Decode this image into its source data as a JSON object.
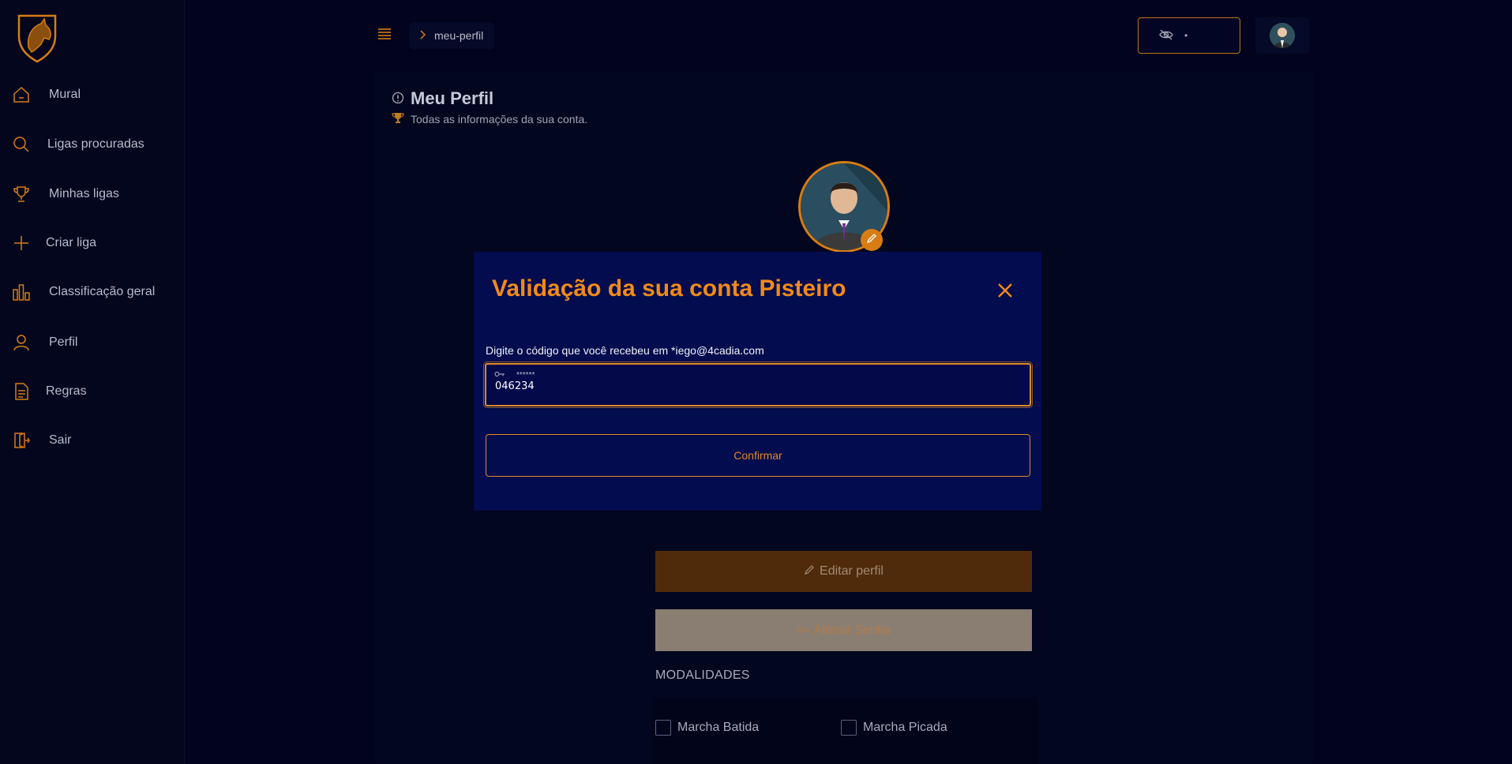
{
  "sidebar": {
    "items": [
      {
        "label": "Mural",
        "icon": "home-icon"
      },
      {
        "label": "Ligas procuradas",
        "icon": "search-icon"
      },
      {
        "label": "Minhas ligas",
        "icon": "trophy-icon"
      },
      {
        "label": "Criar liga",
        "icon": "plus-icon"
      },
      {
        "label": "Classificação geral",
        "icon": "bar-chart-icon"
      },
      {
        "label": "Perfil",
        "icon": "user-icon"
      },
      {
        "label": "Regras",
        "icon": "document-icon"
      },
      {
        "label": "Sair",
        "icon": "logout-icon"
      }
    ]
  },
  "header": {
    "breadcrumb": "meu-perfil",
    "visibility_value": "•"
  },
  "page": {
    "title": "Meu Perfil",
    "subtitle": "Todas as informações da sua conta.",
    "edit_profile_label": "Editar perfil",
    "change_password_label": "Alterar Senha",
    "modalidades_title": "MODALIDADES",
    "modalidades": [
      {
        "label": "Marcha Batida",
        "checked": false
      },
      {
        "label": "Marcha Picada",
        "checked": false
      }
    ]
  },
  "modal": {
    "title": "Validação da sua conta Pisteiro",
    "label": "Digite o código que você recebeu em *iego@4cadia.com",
    "code_placeholder": "******",
    "code_value": "046234",
    "confirm_label": "Confirmar"
  },
  "colors": {
    "accent": "#f08a1a",
    "background": "#01041c",
    "modal_bg": "#030c4e"
  }
}
